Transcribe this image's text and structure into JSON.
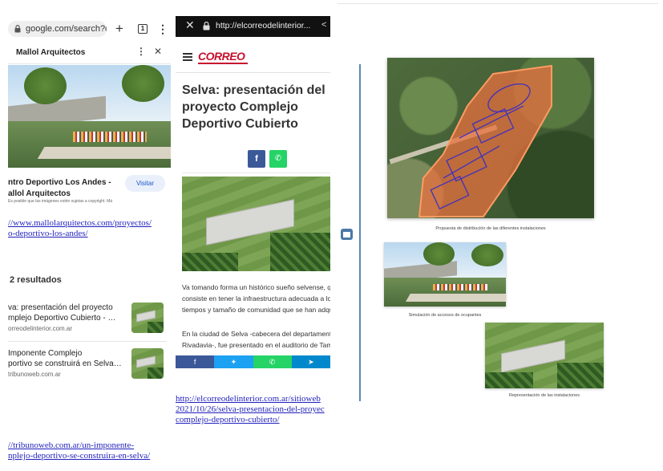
{
  "left": {
    "url": "google.com/search?q",
    "card_title": "Mallol Arquitectos",
    "place_title_line1": "ntro Deportivo Los Andes -",
    "place_title_line2": "allol Arquitectos",
    "place_sub": "Es posible que las imágenes estén sujetas a copyright. Más información",
    "visit_label": "Visitar",
    "link_line1": "//www.mallolarquitectos.com/proyectos/",
    "link_line2": "o-deportivo-los-andes/",
    "results_label": "2 resultados",
    "results": [
      {
        "title_line1": "va: presentación del proyecto",
        "title_line2": "mplejo Deportivo Cubierto - …",
        "source": "orreodelinterior.com.ar"
      },
      {
        "title_line1": "Imponente Complejo",
        "title_line2": "portivo se construirá en Selva…",
        "source": "tribunoweb.com.ar"
      }
    ],
    "bottom_link_line1": "//tribunoweb.com.ar/un-imponente-",
    "bottom_link_line2": "nplejo-deportivo-se-construira-en-selva/"
  },
  "mid": {
    "url": "http://elcorreodelinterior...",
    "logo": "CORREO",
    "title_line1": "Selva: presentación del",
    "title_line2": "proyecto Complejo",
    "title_line3": "Deportivo Cubierto",
    "para1_line1": "Va tomando forma un histórico sueño selvense, q",
    "para1_line2": "consiste en tener la infraestructura adecuada a lo",
    "para1_line3": "tiempos y tamaño de comunidad que se han adqu",
    "para2_line1": "En la ciudad de Selva -cabecera del departamento",
    "para2_line2": "Rivadavia-, fue presentado en el auditorio de Tamb",
    "link_line1": "http://elcorreodelinterior.com.ar/sitioweb",
    "link_line2": "2021/10/26/selva-presentacion-del-proyec",
    "link_line3": "complejo-deportivo-cubierto/"
  },
  "right": {
    "caption1": "Propuesta de distribución de las diferentes instalaciones",
    "caption2": "Simulación de accesos de ocupantes",
    "caption3": "Representación de las instalaciones"
  },
  "colors": {
    "facebook": "#3b5998",
    "twitter": "#1da1f2",
    "whatsapp": "#25d366",
    "telegram": "#0088cc",
    "correo_red": "#c8102e",
    "link_blue": "#1f1fbd",
    "plan_orange": "#e8703f"
  }
}
